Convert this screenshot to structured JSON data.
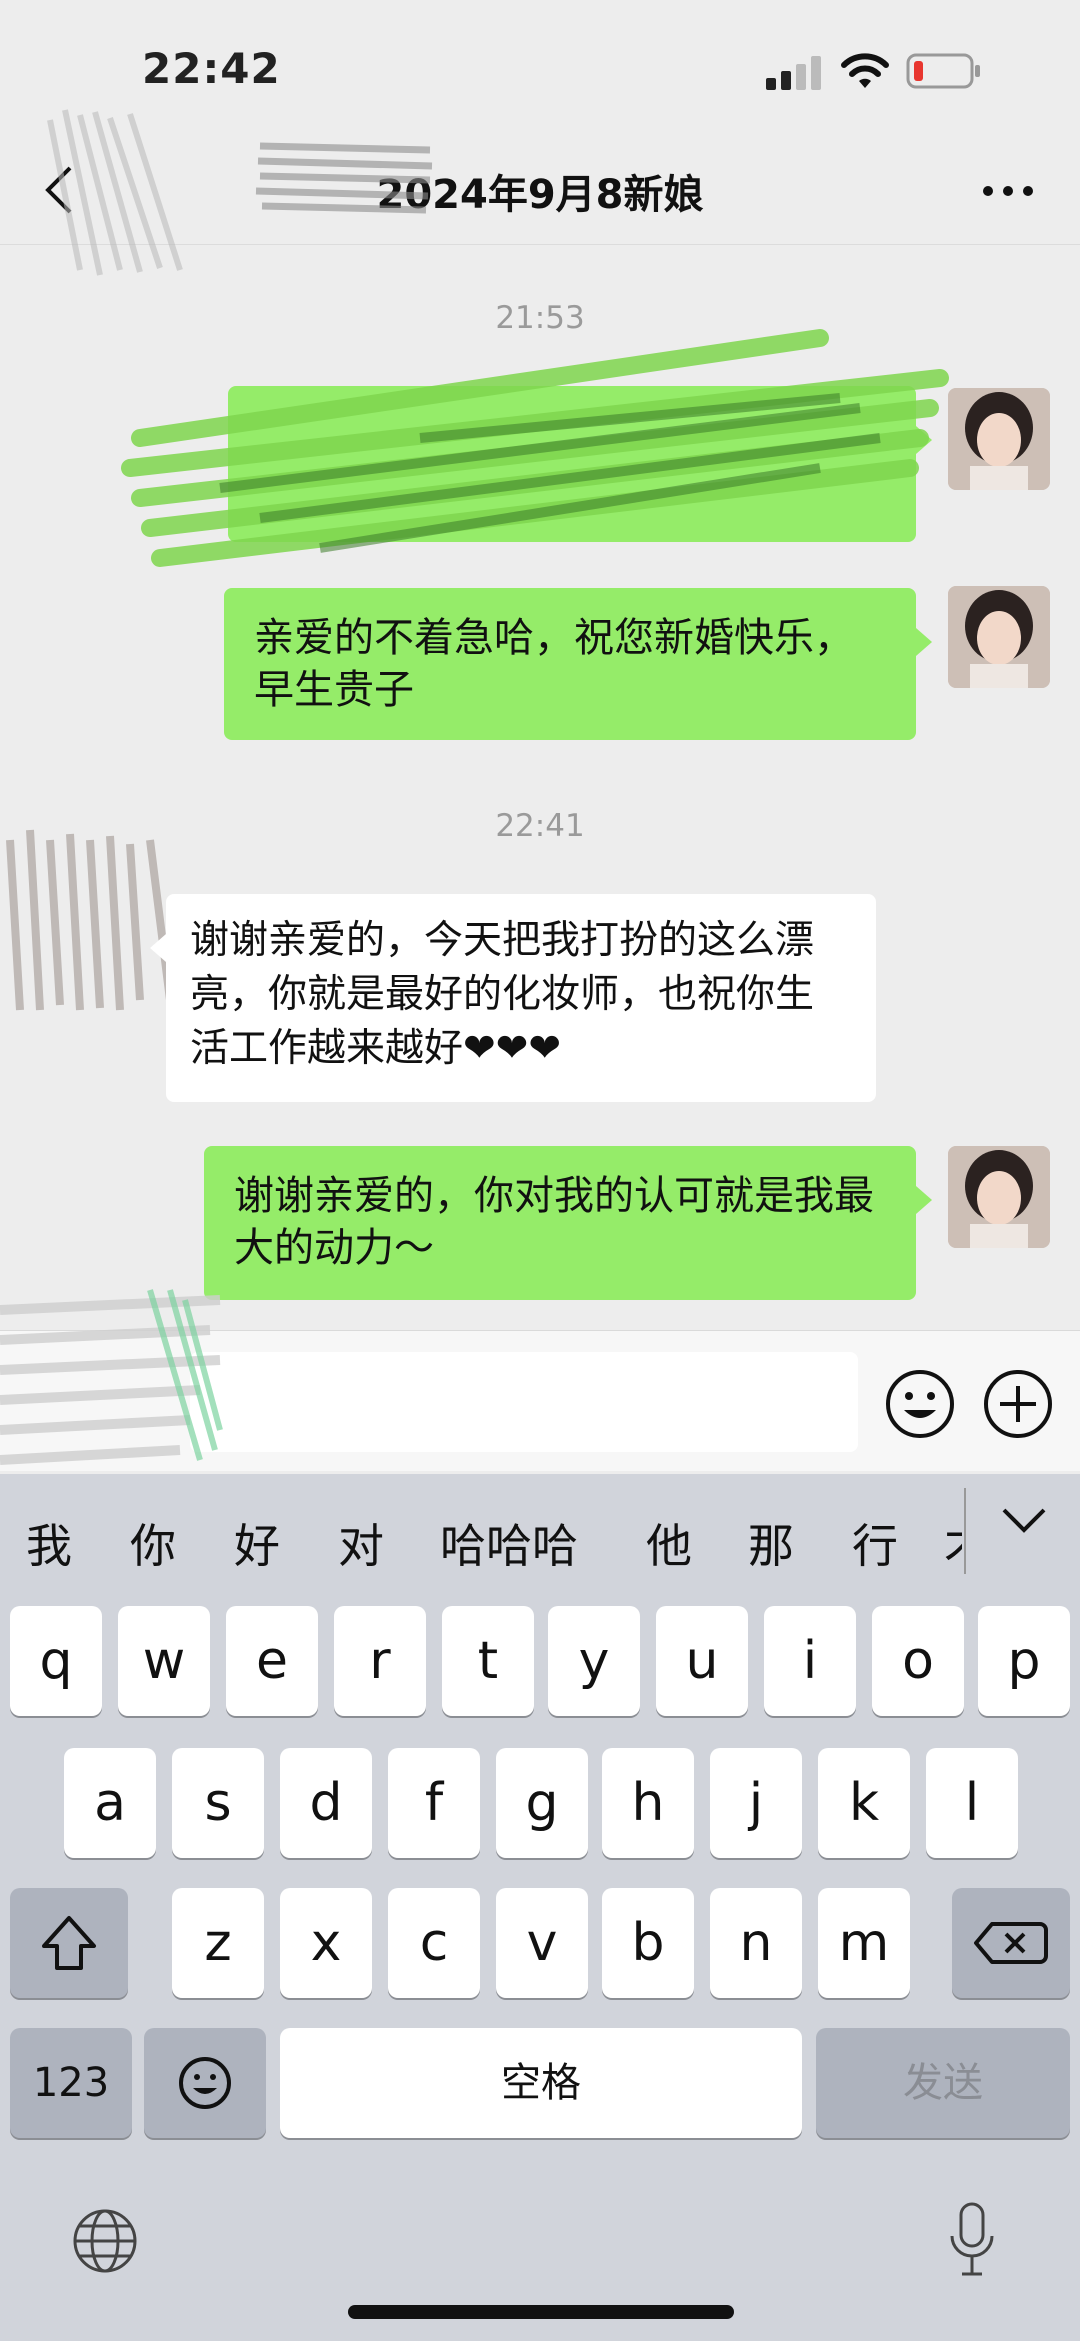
{
  "status_bar": {
    "time": "22:42"
  },
  "nav": {
    "title": "2024年9月8新娘",
    "back_icon": "chevron-left-icon",
    "more_icon": "more-horizontal-icon"
  },
  "chat": {
    "timestamps": [
      "21:53",
      "22:41"
    ],
    "messages": [
      {
        "side": "me",
        "text": "",
        "redacted": true
      },
      {
        "side": "me",
        "text": "亲爱的不着急哈，祝您新婚快乐，早生贵子"
      },
      {
        "side": "them",
        "text": "谢谢亲爱的，今天把我打扮的这么漂亮，你就是最好的化妆师，也祝你生活工作越来越好❤❤❤"
      },
      {
        "side": "me",
        "text": "谢谢亲爱的，你对我的认可就是我最大的动力～"
      }
    ]
  },
  "input": {
    "value": "",
    "emoji_icon": "emoji-face-icon",
    "plus_icon": "plus-circle-icon"
  },
  "keyboard": {
    "candidates": [
      "我",
      "你",
      "好",
      "对",
      "哈哈哈",
      "他",
      "那",
      "行",
      "才"
    ],
    "row1": [
      "q",
      "w",
      "e",
      "r",
      "t",
      "y",
      "u",
      "i",
      "o",
      "p"
    ],
    "row2": [
      "a",
      "s",
      "d",
      "f",
      "g",
      "h",
      "j",
      "k",
      "l"
    ],
    "row3": [
      "z",
      "x",
      "c",
      "v",
      "b",
      "n",
      "m"
    ],
    "numbers_key": "123",
    "space_key": "空格",
    "send_key": "发送",
    "colors": {
      "background": "#d1d4db",
      "key": "#ffffff",
      "special_key": "#aeb3be",
      "bubble_me": "#95ec69"
    }
  }
}
